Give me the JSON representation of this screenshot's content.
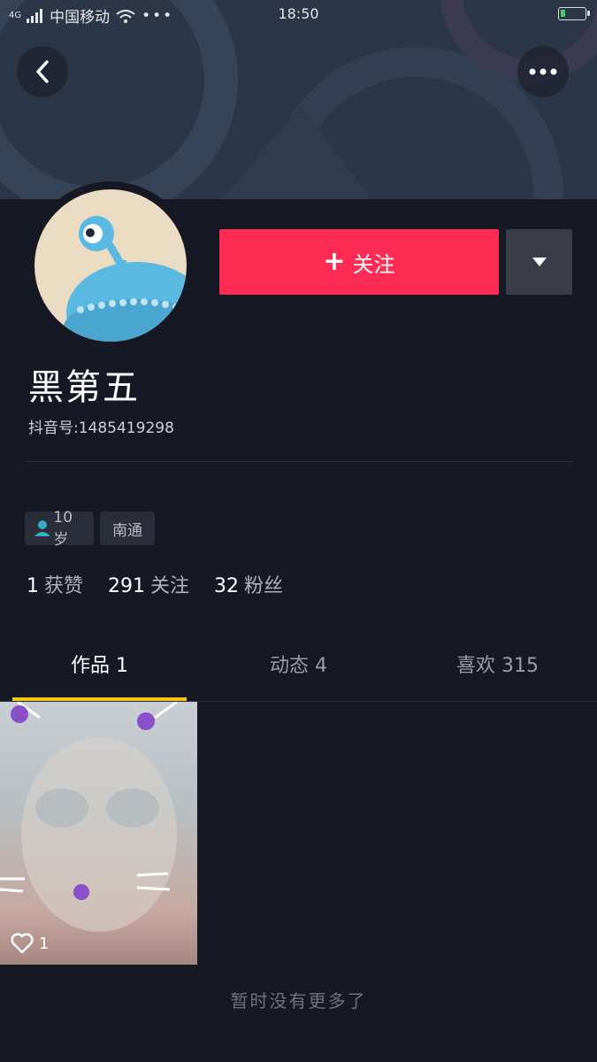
{
  "status_bar": {
    "network": "4G",
    "carrier": "中国移动",
    "time": "18:50"
  },
  "header": {
    "back_icon": "chevron-left-icon",
    "more_icon": "more-dots-icon"
  },
  "profile": {
    "name": "黑第五",
    "douyin_id": "抖音号:1485419298",
    "follow_label": "关注",
    "tags": [
      {
        "label": "10岁",
        "icon": "person-icon"
      },
      {
        "label": "南通"
      }
    ],
    "stats": [
      {
        "value": "1",
        "label": "获赞"
      },
      {
        "value": "291",
        "label": "关注"
      },
      {
        "value": "32",
        "label": "粉丝"
      }
    ]
  },
  "tabs": [
    {
      "label": "作品 1",
      "active": true
    },
    {
      "label": "动态 4",
      "active": false
    },
    {
      "label": "喜欢 315",
      "active": false
    }
  ],
  "videos": [
    {
      "likes": "1"
    }
  ],
  "footer_text": "暂时没有更多了",
  "colors": {
    "accent": "#fe2c55",
    "tab_indicator": "#f5c518",
    "background": "#161824"
  }
}
